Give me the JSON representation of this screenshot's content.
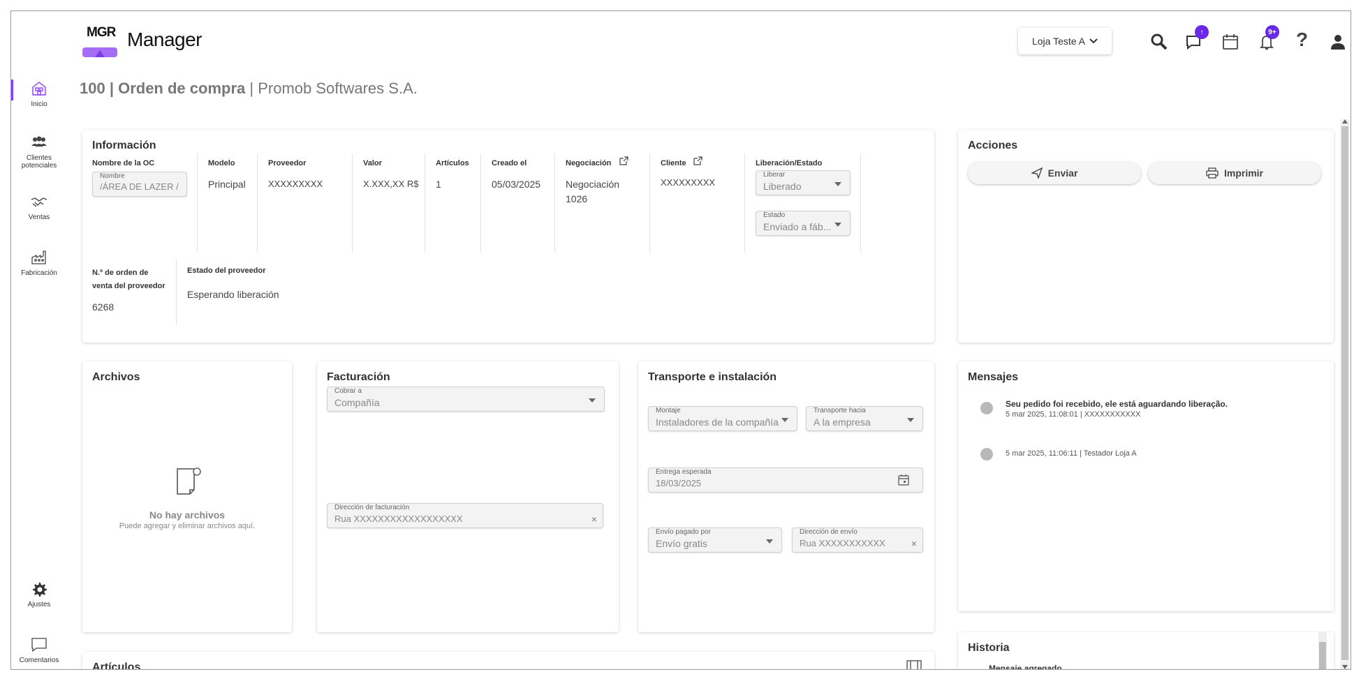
{
  "sidebar": {
    "items": [
      {
        "label": "Inicio",
        "icon": "home-icon"
      },
      {
        "label": "Clientes potenciales",
        "icon": "users-icon"
      },
      {
        "label": "Ventas",
        "icon": "handshake-icon"
      },
      {
        "label": "Fabricación",
        "icon": "factory-icon"
      },
      {
        "label": "Ajustes",
        "icon": "gear-icon"
      },
      {
        "label": "Comentarios",
        "icon": "comment-icon"
      }
    ]
  },
  "header": {
    "logo_text": "MGR",
    "app_name": "Manager",
    "store": "Loja Teste A",
    "chat_badge": "↑",
    "notif_badge": "9+",
    "help": "?"
  },
  "title": {
    "main": "100 | Orden de compra",
    "sep": " | ",
    "company": "Promob Softwares S.A."
  },
  "info": {
    "title": "Información",
    "cols": {
      "name_label": "Nombre de la OC",
      "name_field_label": "Nombre",
      "name_value": "/ÁREA DE LAZER /",
      "model_label": "Modelo",
      "model_value": "Principal",
      "supplier_label": "Proveedor",
      "supplier_value": "XXXXXXXXX",
      "value_label": "Valor",
      "value_value": "X.XXX,XX R$",
      "items_label": "Artículos",
      "items_value": "1",
      "created_label": "Creado el",
      "created_value": "05/03/2025",
      "negotiation_label": "Negociación",
      "negotiation_value_1": "Negociación",
      "negotiation_value_2": "1026",
      "client_label": "Cliente",
      "client_value": "XXXXXXXXX",
      "release_label": "Liberación/Estado",
      "release_field_label": "Liberar",
      "release_value": "Liberado",
      "state_field_label": "Estado",
      "state_value": "Enviado a fáb...",
      "order_label_1": "N.º de orden de",
      "order_label_2": "venta del proveedor",
      "order_value": "6268",
      "supplier_state_label": "Estado del proveedor",
      "supplier_state_value": "Esperando liberación"
    }
  },
  "actions": {
    "title": "Acciones",
    "send": "Enviar",
    "print": "Imprimir"
  },
  "files": {
    "title": "Archivos",
    "empty_title": "No hay archivos",
    "empty_sub": "Puede agregar y eliminar archivos aquí."
  },
  "billing": {
    "title": "Facturación",
    "charge_label": "Cobrar a",
    "charge_value": "Compañía",
    "address_label": "Dirección de facturación",
    "address_value": "Rua XXXXXXXXXXXXXXXXXX"
  },
  "transport": {
    "title": "Transporte e instalación",
    "assembly_label": "Montaje",
    "assembly_value": "Instaladores de la compañía",
    "transport_label": "Transporte hacia",
    "transport_value": "A la empresa",
    "delivery_label": "Entrega esperada",
    "delivery_value": "18/03/2025",
    "shipping_label": "Envío pagado por",
    "shipping_value": "Envío gratis",
    "ship_addr_label": "Dirección de envío",
    "ship_addr_value": "Rua XXXXXXXXXXX"
  },
  "messages": {
    "title": "Mensajes",
    "items": [
      {
        "text": "Seu pedido foi recebido, ele está aguardando liberação.",
        "meta": "5 mar 2025, 11:08:01 | XXXXXXXXXXX"
      },
      {
        "text": "",
        "meta": "5 mar 2025, 11:06:11 | Testador Loja A"
      }
    ]
  },
  "history": {
    "title": "Historia",
    "first": "Mensaje agregado"
  },
  "articles": {
    "title": "Artículos"
  },
  "colors": {
    "accent": "#8a3ffc",
    "badge": "#6a29e6",
    "logo_base": "#a56cf5"
  }
}
